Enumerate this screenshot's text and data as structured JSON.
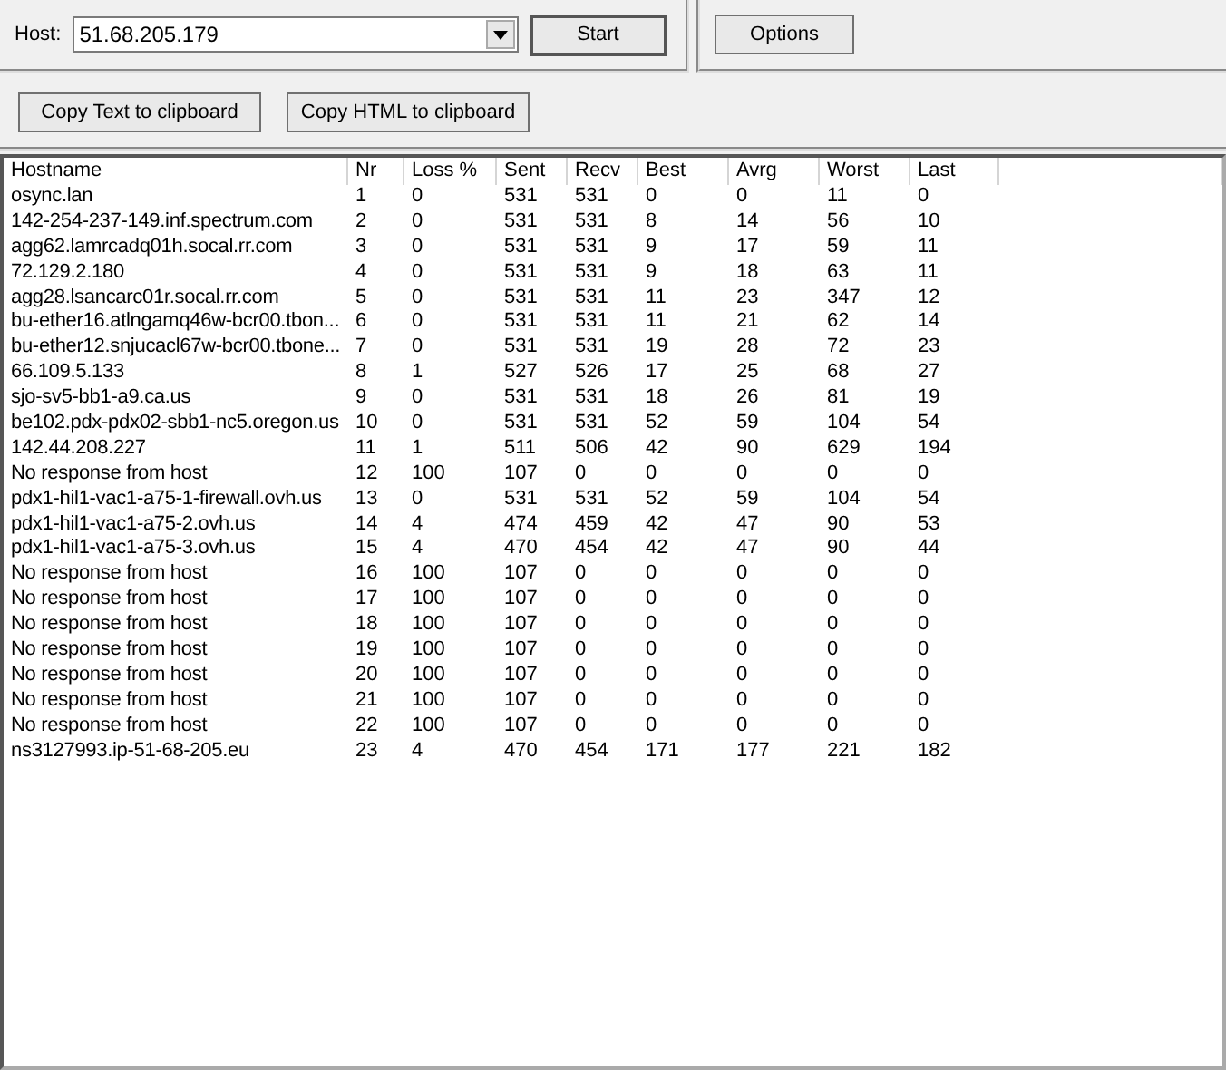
{
  "host": {
    "label": "Host:",
    "value": "51.68.205.179"
  },
  "buttons": {
    "start": "Start",
    "options": "Options",
    "copy_text": "Copy Text to clipboard",
    "copy_html": "Copy HTML to clipboard"
  },
  "table": {
    "columns": [
      "Hostname",
      "Nr",
      "Loss %",
      "Sent",
      "Recv",
      "Best",
      "Avrg",
      "Worst",
      "Last"
    ],
    "rows": [
      [
        "osync.lan",
        "1",
        "0",
        "531",
        "531",
        "0",
        "0",
        "11",
        "0"
      ],
      [
        "142-254-237-149.inf.spectrum.com",
        "2",
        "0",
        "531",
        "531",
        "8",
        "14",
        "56",
        "10"
      ],
      [
        "agg62.lamrcadq01h.socal.rr.com",
        "3",
        "0",
        "531",
        "531",
        "9",
        "17",
        "59",
        "11"
      ],
      [
        "72.129.2.180",
        "4",
        "0",
        "531",
        "531",
        "9",
        "18",
        "63",
        "11"
      ],
      [
        "agg28.lsancarc01r.socal.rr.com",
        "5",
        "0",
        "531",
        "531",
        "11",
        "23",
        "347",
        "12"
      ],
      [
        "bu-ether16.atlngamq46w-bcr00.tbon...",
        "6",
        "0",
        "531",
        "531",
        "11",
        "21",
        "62",
        "14"
      ],
      [
        "bu-ether12.snjucacl67w-bcr00.tbone...",
        "7",
        "0",
        "531",
        "531",
        "19",
        "28",
        "72",
        "23"
      ],
      [
        "66.109.5.133",
        "8",
        "1",
        "527",
        "526",
        "17",
        "25",
        "68",
        "27"
      ],
      [
        "sjo-sv5-bb1-a9.ca.us",
        "9",
        "0",
        "531",
        "531",
        "18",
        "26",
        "81",
        "19"
      ],
      [
        "be102.pdx-pdx02-sbb1-nc5.oregon.us",
        "10",
        "0",
        "531",
        "531",
        "52",
        "59",
        "104",
        "54"
      ],
      [
        "142.44.208.227",
        "11",
        "1",
        "511",
        "506",
        "42",
        "90",
        "629",
        "194"
      ],
      [
        "No response from host",
        "12",
        "100",
        "107",
        "0",
        "0",
        "0",
        "0",
        "0"
      ],
      [
        "pdx1-hil1-vac1-a75-1-firewall.ovh.us",
        "13",
        "0",
        "531",
        "531",
        "52",
        "59",
        "104",
        "54"
      ],
      [
        "pdx1-hil1-vac1-a75-2.ovh.us",
        "14",
        "4",
        "474",
        "459",
        "42",
        "47",
        "90",
        "53"
      ],
      [
        "pdx1-hil1-vac1-a75-3.ovh.us",
        "15",
        "4",
        "470",
        "454",
        "42",
        "47",
        "90",
        "44"
      ],
      [
        "No response from host",
        "16",
        "100",
        "107",
        "0",
        "0",
        "0",
        "0",
        "0"
      ],
      [
        "No response from host",
        "17",
        "100",
        "107",
        "0",
        "0",
        "0",
        "0",
        "0"
      ],
      [
        "No response from host",
        "18",
        "100",
        "107",
        "0",
        "0",
        "0",
        "0",
        "0"
      ],
      [
        "No response from host",
        "19",
        "100",
        "107",
        "0",
        "0",
        "0",
        "0",
        "0"
      ],
      [
        "No response from host",
        "20",
        "100",
        "107",
        "0",
        "0",
        "0",
        "0",
        "0"
      ],
      [
        "No response from host",
        "21",
        "100",
        "107",
        "0",
        "0",
        "0",
        "0",
        "0"
      ],
      [
        "No response from host",
        "22",
        "100",
        "107",
        "0",
        "0",
        "0",
        "0",
        "0"
      ],
      [
        "ns3127993.ip-51-68-205.eu",
        "23",
        "4",
        "470",
        "454",
        "171",
        "177",
        "221",
        "182"
      ]
    ]
  }
}
